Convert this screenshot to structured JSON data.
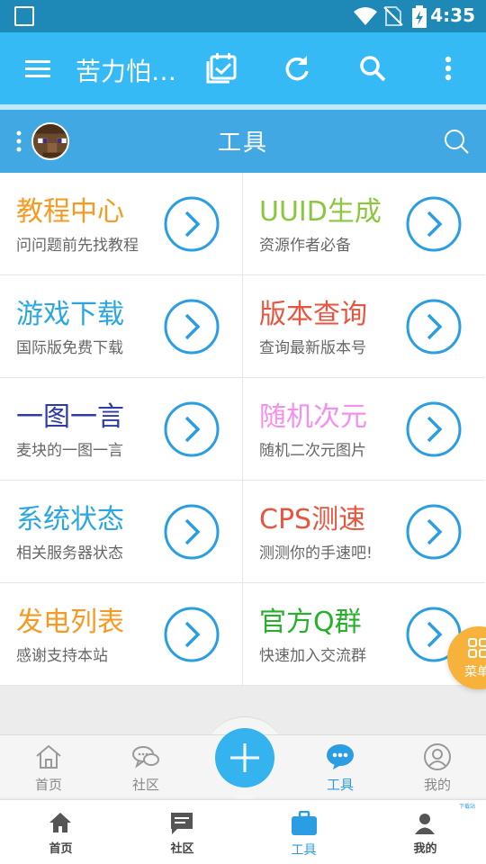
{
  "status_bar": {
    "time": "4:35"
  },
  "app_bar": {
    "title": "苦力怕…"
  },
  "sub_header": {
    "title": "工具"
  },
  "tools": [
    {
      "title": "教程中心",
      "subtitle": "问问题前先找教程",
      "color": "#f59a23"
    },
    {
      "title": "UUID生成",
      "subtitle": "资源作者必备",
      "color": "#8cc63f"
    },
    {
      "title": "游戏下载",
      "subtitle": "国际版免费下载",
      "color": "#2aa7e0"
    },
    {
      "title": "版本查询",
      "subtitle": "查询最新版本号",
      "color": "#e8553f"
    },
    {
      "title": "一图一言",
      "subtitle": "麦块的一图一言",
      "color": "#2d3aa8"
    },
    {
      "title": "随机次元",
      "subtitle": "随机二次元图片",
      "color": "#f48fef"
    },
    {
      "title": "系统状态",
      "subtitle": "相关服务器状态",
      "color": "#2aa7e0"
    },
    {
      "title": "CPS测速",
      "subtitle": "测测你的手速吧!",
      "color": "#e8553f"
    },
    {
      "title": "发电列表",
      "subtitle": "感谢支持本站",
      "color": "#f59a23"
    },
    {
      "title": "官方Q群",
      "subtitle": "快速加入交流群",
      "color": "#27b02c"
    }
  ],
  "floating_menu": {
    "label": "菜单"
  },
  "inner_nav": [
    {
      "label": "首页",
      "icon": "home-outline-icon"
    },
    {
      "label": "社区",
      "icon": "chat-bubbles-icon"
    },
    {
      "label": "工具",
      "icon": "chat-dots-icon"
    },
    {
      "label": "我的",
      "icon": "user-circle-icon"
    }
  ],
  "outer_nav": [
    {
      "label": "首页",
      "icon": "home-icon"
    },
    {
      "label": "社区",
      "icon": "message-icon"
    },
    {
      "label": "工具",
      "icon": "toolbox-icon"
    },
    {
      "label": "我的",
      "icon": "person-icon"
    }
  ],
  "outer_nav_small_text": "下载站",
  "colors": {
    "status_bar": "#1e88b7",
    "app_bar": "#35baf6",
    "sub_header": "#41a8e4",
    "accent": "#2b9de3",
    "menu_fab": "#f7b23b"
  }
}
